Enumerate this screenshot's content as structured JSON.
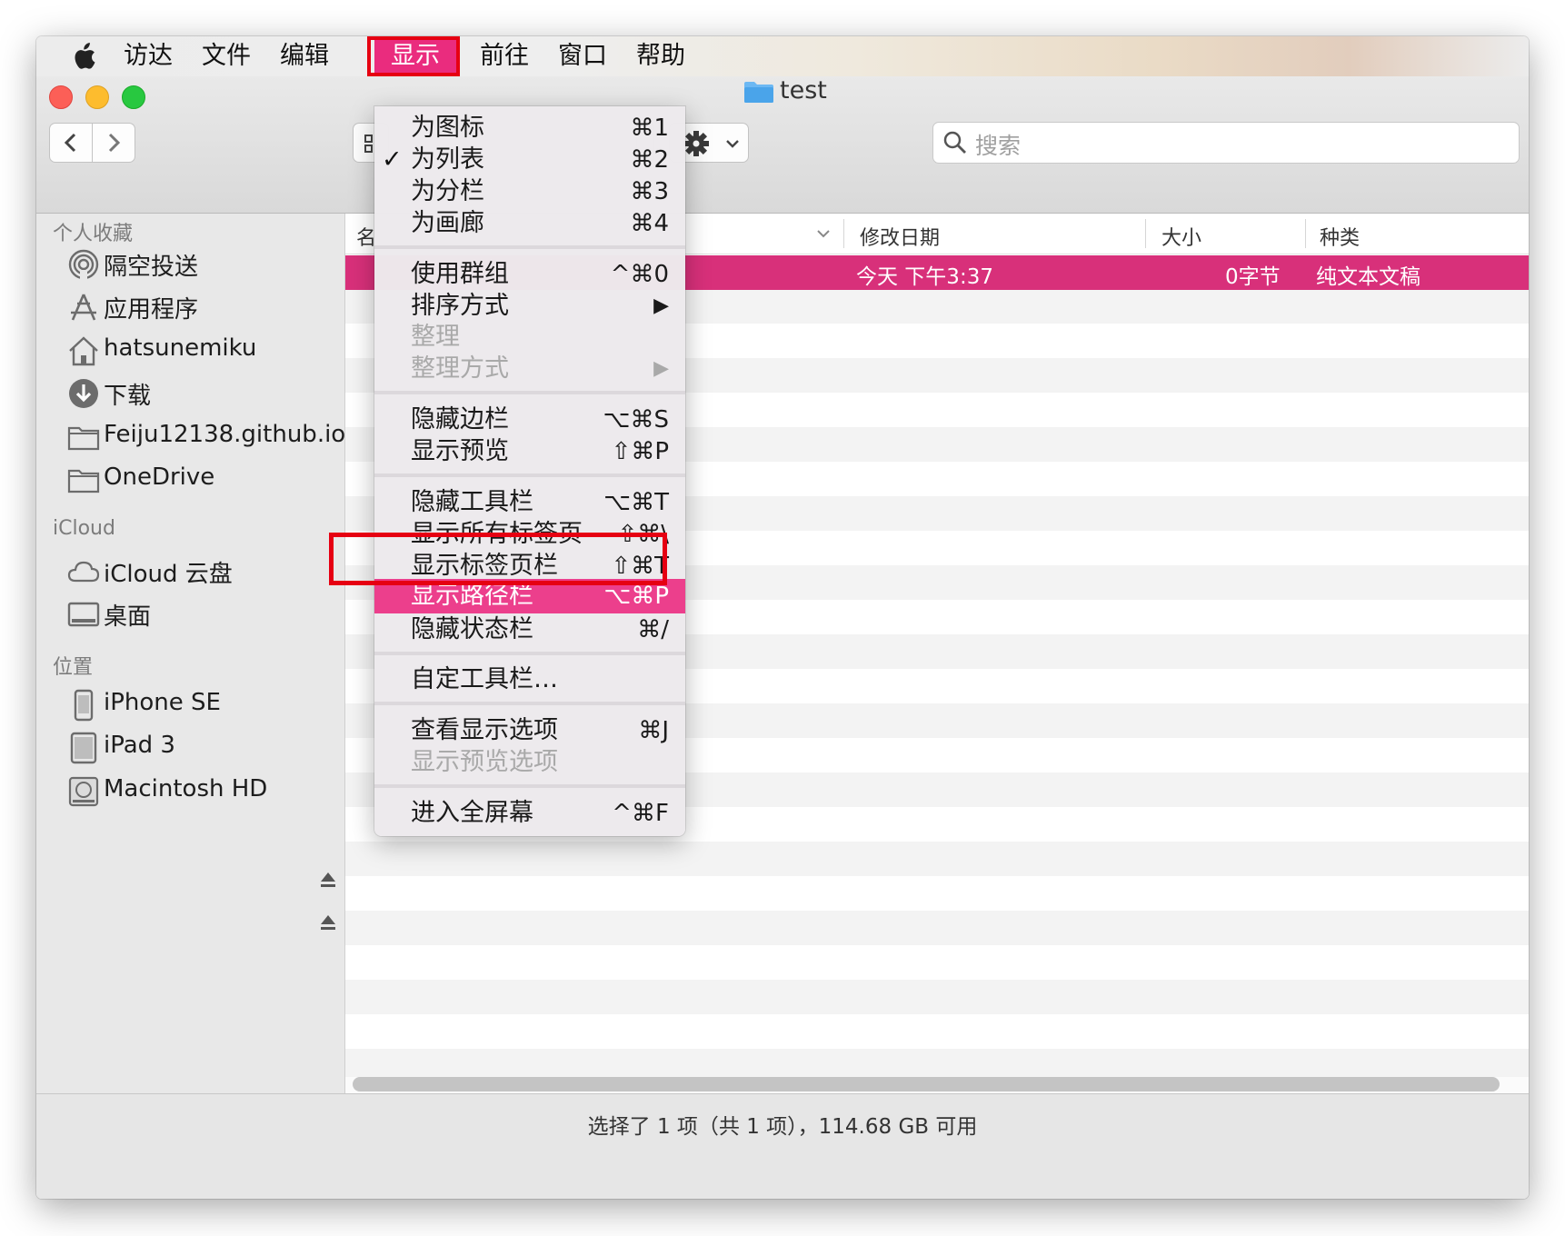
{
  "menubar": {
    "items": [
      "访达",
      "文件",
      "编辑",
      "显示",
      "前往",
      "窗口",
      "帮助"
    ],
    "active_index": 3,
    "accent": "#ea2c7e",
    "annotation_color": "#e60012"
  },
  "window": {
    "title": "test"
  },
  "search": {
    "placeholder": "搜索"
  },
  "sidebar": {
    "favorites_header": "个人收藏",
    "favorites": [
      {
        "label": "隔空投送",
        "icon": "airdrop-icon"
      },
      {
        "label": "应用程序",
        "icon": "applications-icon"
      },
      {
        "label": "hatsunemiku",
        "icon": "home-icon"
      },
      {
        "label": "下载",
        "icon": "download-icon"
      },
      {
        "label": "Feiju12138.github.io",
        "icon": "folder-icon"
      },
      {
        "label": "OneDrive",
        "icon": "folder-icon"
      }
    ],
    "icloud_header": "iCloud",
    "icloud": [
      {
        "label": "iCloud 云盘",
        "icon": "cloud-icon"
      },
      {
        "label": "桌面",
        "icon": "desktop-icon"
      }
    ],
    "locations_header": "位置",
    "locations": [
      {
        "label": "iPhone SE",
        "icon": "iphone-icon",
        "eject": true
      },
      {
        "label": "iPad 3",
        "icon": "ipad-icon",
        "eject": true
      },
      {
        "label": "Macintosh HD",
        "icon": "harddisk-icon",
        "eject": false
      }
    ]
  },
  "list": {
    "columns": {
      "name": "名",
      "modified": "修改日期",
      "size": "大小",
      "kind": "种类"
    },
    "selected_row": {
      "modified": "今天 下午3:37",
      "size": "0字节",
      "kind": "纯文本文稿"
    }
  },
  "status": {
    "text": "选择了 1 项（共 1 项），114.68 GB 可用"
  },
  "menu": {
    "items": [
      {
        "label": "为图标",
        "key": "⌘1"
      },
      {
        "label": "为列表",
        "key": "⌘2",
        "checked": true
      },
      {
        "label": "为分栏",
        "key": "⌘3"
      },
      {
        "label": "为画廊",
        "key": "⌘4"
      },
      {
        "label": "使用群组",
        "key": "^⌘0"
      },
      {
        "label": "排序方式",
        "key": "▶"
      },
      {
        "label": "整理",
        "key": "",
        "disabled": true
      },
      {
        "label": "整理方式",
        "key": "▶",
        "disabled": true
      },
      {
        "label": "隐藏边栏",
        "key": "⌥⌘S"
      },
      {
        "label": "显示预览",
        "key": "⇧⌘P"
      },
      {
        "label": "隐藏工具栏",
        "key": "⌥⌘T"
      },
      {
        "label": "显示所有标签页",
        "key": "⇧⌘\\"
      },
      {
        "label": "显示标签页栏",
        "key": "⇧⌘T"
      },
      {
        "label": "显示路径栏",
        "key": "⌥⌘P",
        "highlighted": true
      },
      {
        "label": "隐藏状态栏",
        "key": "⌘/"
      },
      {
        "label": "自定工具栏…",
        "key": ""
      },
      {
        "label": "查看显示选项",
        "key": "⌘J"
      },
      {
        "label": "显示预览选项",
        "key": "",
        "disabled": true
      },
      {
        "label": "进入全屏幕",
        "key": "^⌘F"
      }
    ]
  }
}
